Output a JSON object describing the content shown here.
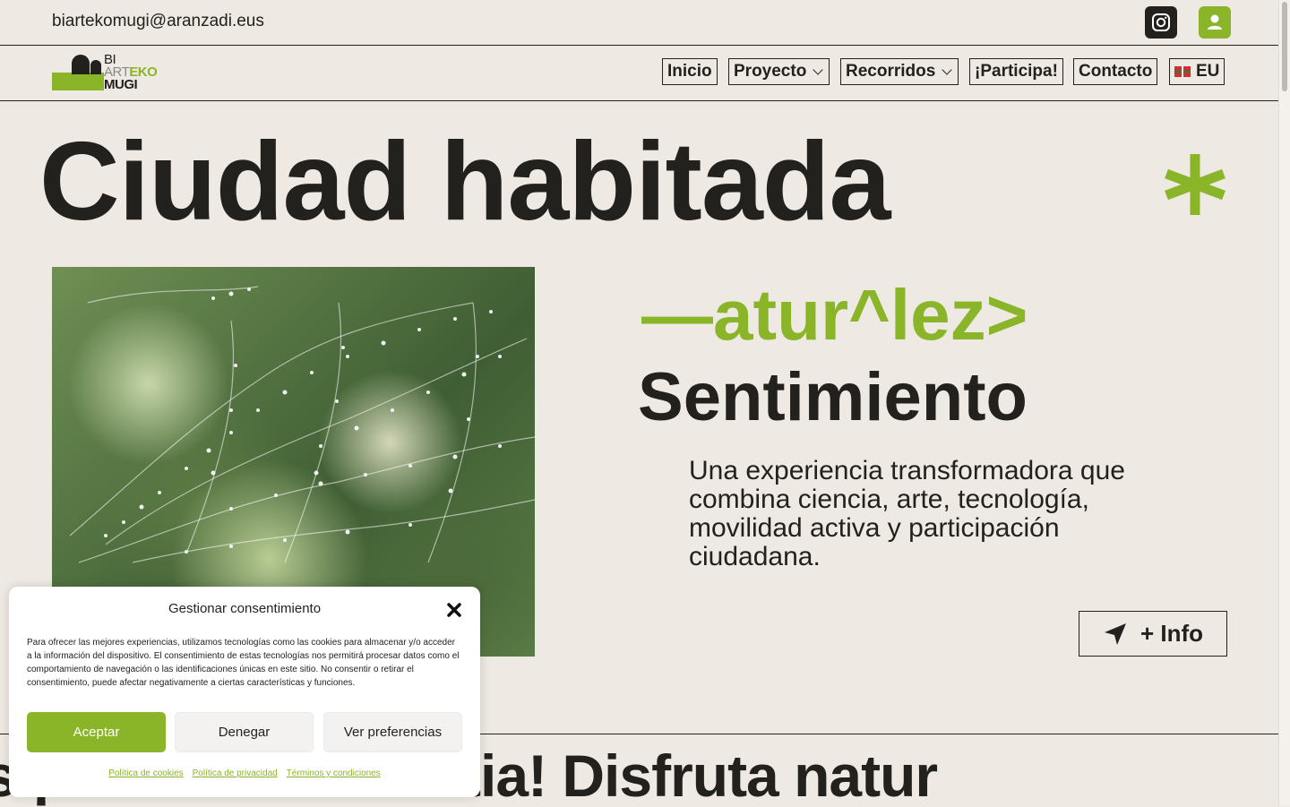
{
  "topbar": {
    "email": "biartekomugi@aranzadi.eus"
  },
  "logo": {
    "line1": "BI",
    "line2a": "ART",
    "line2b": "EKO",
    "line3": "MUGI"
  },
  "nav": {
    "inicio": "Inicio",
    "proyecto": "Proyecto",
    "recorridos": "Recorridos",
    "participa": "¡Participa!",
    "contacto": "Contacto",
    "lang": "EU"
  },
  "hero": {
    "title": "Ciudad habitada",
    "accent_word": "—atur^lez>",
    "word": "Sentimiento",
    "description": "Una experiencia transformadora que combina ciencia, arte, tecnología, movilidad activa y participación ciudadana.",
    "info_button": "+ Info"
  },
  "marquee": {
    "text": "s ¡Disfruta Donostia! Disfruta natur"
  },
  "cookie": {
    "title": "Gestionar consentimiento",
    "text": "Para ofrecer las mejores experiencias, utilizamos tecnologías como las cookies para almacenar y/o acceder a la información del dispositivo. El consentimiento de estas tecnologías nos permitirá procesar datos como el comportamiento de navegación o las identificaciones únicas en este sitio. No consentir o retirar el consentimiento, puede afectar negativamente a ciertas características y funciones.",
    "accept": "Aceptar",
    "deny": "Denegar",
    "preferences": "Ver preferencias",
    "links": [
      "Política de cookies",
      "Política de privacidad",
      "Términos y condiciones"
    ]
  },
  "colors": {
    "accent": "#8ab529",
    "ink": "#22211d",
    "background": "#eee9e3"
  },
  "icons": {
    "social": "instagram-icon",
    "account": "user-icon",
    "info": "location-arrow-icon",
    "close": "close-icon"
  }
}
